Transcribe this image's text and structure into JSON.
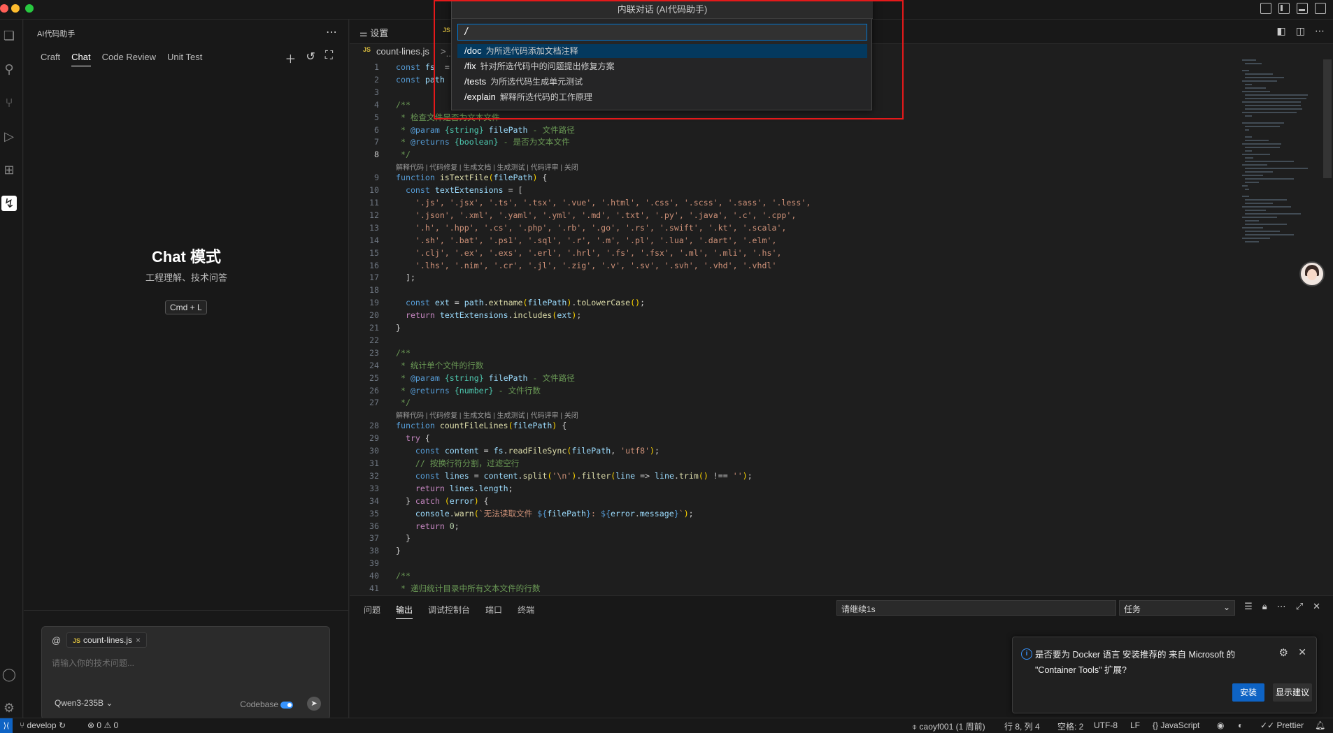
{
  "window": {
    "title": "内联对话 (AI代码助手)"
  },
  "sidebar": {
    "title": "AI代码助手",
    "tabs": [
      {
        "label": "Craft"
      },
      {
        "label": "Chat"
      },
      {
        "label": "Code Review"
      },
      {
        "label": "Unit Test"
      }
    ],
    "active_tab": "Chat",
    "mode_title": "Chat 模式",
    "mode_subtitle": "工程理解、技术问答",
    "shortcut": "Cmd + L",
    "chat_input": {
      "at": "@",
      "context_file": "count-lines.js",
      "placeholder": "请输入你的技术问题...",
      "model": "Qwen3-235B",
      "codebase_label": "Codebase",
      "codebase_enabled": true
    }
  },
  "tabs": {
    "settings": "设置",
    "file": "count-lines.js"
  },
  "breadcrumb": {
    "file": "count-lines.js",
    "rest": "..."
  },
  "inline_chat": {
    "input_value": "/",
    "commands": [
      {
        "cmd": "/doc",
        "desc": "为所选代码添加文档注释"
      },
      {
        "cmd": "/fix",
        "desc": "针对所选代码中的问题提出修复方案"
      },
      {
        "cmd": "/tests",
        "desc": "为所选代码生成单元测试"
      },
      {
        "cmd": "/explain",
        "desc": "解释所选代码的工作原理"
      }
    ]
  },
  "code_lens": "解释代码 | 代码修复 | 生成文档 | 生成测试 | 代码评审 | 关闭",
  "current_line": 8,
  "code_lines": [
    {
      "n": "1",
      "tokens": [
        [
          "k",
          "const "
        ],
        [
          "v",
          "fs"
        ],
        [
          "",
          "  = "
        ]
      ]
    },
    {
      "n": "2",
      "tokens": [
        [
          "k",
          "const "
        ],
        [
          "v",
          "path"
        ]
      ]
    },
    {
      "n": "3",
      "tokens": []
    },
    {
      "n": "4",
      "tokens": [
        [
          "c",
          "/**"
        ]
      ]
    },
    {
      "n": "5",
      "tokens": [
        [
          "c",
          " * 检查文件是否为文本文件"
        ]
      ]
    },
    {
      "n": "6",
      "tokens": [
        [
          "c",
          " * "
        ],
        [
          "k",
          "@param "
        ],
        [
          "t",
          "{string} "
        ],
        [
          "v",
          "filePath"
        ],
        [
          "c",
          " - 文件路径"
        ]
      ]
    },
    {
      "n": "7",
      "tokens": [
        [
          "c",
          " * "
        ],
        [
          "k",
          "@returns "
        ],
        [
          "t",
          "{boolean}"
        ],
        [
          "c",
          " - 是否为文本文件"
        ]
      ]
    },
    {
      "n": "8",
      "tokens": [
        [
          "c",
          " */"
        ]
      ]
    },
    {
      "n": "9",
      "tokens": [
        [
          "k",
          "function "
        ],
        [
          "f",
          "isTextFile"
        ],
        [
          "p",
          "("
        ],
        [
          "v",
          "filePath"
        ],
        [
          "p",
          ")"
        ],
        [
          "",
          " {"
        ]
      ]
    },
    {
      "n": "10",
      "tokens": [
        [
          "",
          "  "
        ],
        [
          "k",
          "const "
        ],
        [
          "v",
          "textExtensions"
        ],
        [
          "",
          " = ["
        ]
      ]
    },
    {
      "n": "11",
      "tokens": [
        [
          "s",
          "    '.js', '.jsx', '.ts', '.tsx', '.vue', '.html', '.css', '.scss', '.sass', '.less',"
        ]
      ]
    },
    {
      "n": "12",
      "tokens": [
        [
          "s",
          "    '.json', '.xml', '.yaml', '.yml', '.md', '.txt', '.py', '.java', '.c', '.cpp',"
        ]
      ]
    },
    {
      "n": "13",
      "tokens": [
        [
          "s",
          "    '.h', '.hpp', '.cs', '.php', '.rb', '.go', '.rs', '.swift', '.kt', '.scala',"
        ]
      ]
    },
    {
      "n": "14",
      "tokens": [
        [
          "s",
          "    '.sh', '.bat', '.ps1', '.sql', '.r', '.m', '.pl', '.lua', '.dart', '.elm',"
        ]
      ]
    },
    {
      "n": "15",
      "tokens": [
        [
          "s",
          "    '.clj', '.ex', '.exs', '.erl', '.hrl', '.fs', '.fsx', '.ml', '.mli', '.hs',"
        ]
      ]
    },
    {
      "n": "16",
      "tokens": [
        [
          "s",
          "    '.lhs', '.nim', '.cr', '.jl', '.zig', '.v', '.sv', '.svh', '.vhd', '.vhdl'"
        ]
      ]
    },
    {
      "n": "17",
      "tokens": [
        [
          "",
          "  ];"
        ]
      ]
    },
    {
      "n": "18",
      "tokens": []
    },
    {
      "n": "19",
      "tokens": [
        [
          "",
          "  "
        ],
        [
          "k",
          "const "
        ],
        [
          "v",
          "ext"
        ],
        [
          "",
          " = "
        ],
        [
          "v",
          "path"
        ],
        [
          "",
          "."
        ],
        [
          "f",
          "extname"
        ],
        [
          "p",
          "("
        ],
        [
          "v",
          "filePath"
        ],
        [
          "p",
          ")"
        ],
        [
          "",
          "."
        ],
        [
          "f",
          "toLowerCase"
        ],
        [
          "p",
          "()"
        ],
        [
          ";",
          ";"
        ]
      ]
    },
    {
      "n": "20",
      "tokens": [
        [
          "",
          "  "
        ],
        [
          "kc",
          "return "
        ],
        [
          "v",
          "textExtensions"
        ],
        [
          "",
          "."
        ],
        [
          "f",
          "includes"
        ],
        [
          "p",
          "("
        ],
        [
          "v",
          "ext"
        ],
        [
          "p",
          ")"
        ],
        [
          "",
          ";"
        ]
      ]
    },
    {
      "n": "21",
      "tokens": [
        [
          "",
          "}"
        ]
      ]
    },
    {
      "n": "22",
      "tokens": []
    },
    {
      "n": "23",
      "tokens": [
        [
          "c",
          "/**"
        ]
      ]
    },
    {
      "n": "24",
      "tokens": [
        [
          "c",
          " * 统计单个文件的行数"
        ]
      ]
    },
    {
      "n": "25",
      "tokens": [
        [
          "c",
          " * "
        ],
        [
          "k",
          "@param "
        ],
        [
          "t",
          "{string} "
        ],
        [
          "v",
          "filePath"
        ],
        [
          "c",
          " - 文件路径"
        ]
      ]
    },
    {
      "n": "26",
      "tokens": [
        [
          "c",
          " * "
        ],
        [
          "k",
          "@returns "
        ],
        [
          "t",
          "{number}"
        ],
        [
          "c",
          " - 文件行数"
        ]
      ]
    },
    {
      "n": "27",
      "tokens": [
        [
          "c",
          " */"
        ]
      ]
    },
    {
      "n": "28",
      "tokens": [
        [
          "k",
          "function "
        ],
        [
          "f",
          "countFileLines"
        ],
        [
          "p",
          "("
        ],
        [
          "v",
          "filePath"
        ],
        [
          "p",
          ")"
        ],
        [
          "",
          " {"
        ]
      ]
    },
    {
      "n": "29",
      "tokens": [
        [
          "",
          "  "
        ],
        [
          "kc",
          "try "
        ],
        [
          "",
          "{"
        ]
      ]
    },
    {
      "n": "30",
      "tokens": [
        [
          "",
          "    "
        ],
        [
          "k",
          "const "
        ],
        [
          "v",
          "content"
        ],
        [
          "",
          " = "
        ],
        [
          "v",
          "fs"
        ],
        [
          "",
          "."
        ],
        [
          "f",
          "readFileSync"
        ],
        [
          "p",
          "("
        ],
        [
          "v",
          "filePath"
        ],
        [
          "",
          ", "
        ],
        [
          "s",
          "'utf8'"
        ],
        [
          "p",
          ")"
        ],
        [
          "",
          ";"
        ]
      ]
    },
    {
      "n": "31",
      "tokens": [
        [
          "c",
          "    // 按换行符分割，过滤空行"
        ]
      ]
    },
    {
      "n": "32",
      "tokens": [
        [
          "",
          "    "
        ],
        [
          "k",
          "const "
        ],
        [
          "v",
          "lines"
        ],
        [
          "",
          " = "
        ],
        [
          "v",
          "content"
        ],
        [
          "",
          "."
        ],
        [
          "f",
          "split"
        ],
        [
          "p",
          "("
        ],
        [
          "s",
          "'\\n'"
        ],
        [
          "p",
          ")"
        ],
        [
          "",
          "."
        ],
        [
          "f",
          "filter"
        ],
        [
          "p",
          "("
        ],
        [
          "v",
          "line"
        ],
        [
          "",
          " => "
        ],
        [
          "v",
          "line"
        ],
        [
          "",
          "."
        ],
        [
          "f",
          "trim"
        ],
        [
          "p",
          "()"
        ],
        [
          "",
          " !== "
        ],
        [
          "s",
          "''"
        ],
        [
          "p",
          ")"
        ],
        [
          "",
          ";"
        ]
      ]
    },
    {
      "n": "33",
      "tokens": [
        [
          "",
          "    "
        ],
        [
          "kc",
          "return "
        ],
        [
          "v",
          "lines"
        ],
        [
          "",
          "."
        ],
        [
          "v",
          "length"
        ],
        [
          "",
          ";"
        ]
      ]
    },
    {
      "n": "34",
      "tokens": [
        [
          "",
          "  } "
        ],
        [
          "kc",
          "catch "
        ],
        [
          "p",
          "("
        ],
        [
          "v",
          "error"
        ],
        [
          "p",
          ")"
        ],
        [
          "",
          " {"
        ]
      ]
    },
    {
      "n": "35",
      "tokens": [
        [
          "",
          "    "
        ],
        [
          "v",
          "console"
        ],
        [
          "",
          "."
        ],
        [
          "f",
          "warn"
        ],
        [
          "p",
          "("
        ],
        [
          "s",
          "`无法读取文件 "
        ],
        [
          "k",
          "${"
        ],
        [
          "v",
          "filePath"
        ],
        [
          "k",
          "}"
        ],
        [
          "s",
          ": "
        ],
        [
          "k",
          "${"
        ],
        [
          "v",
          "error"
        ],
        [
          "",
          "."
        ],
        [
          "v",
          "message"
        ],
        [
          "k",
          "}"
        ],
        [
          "s",
          "`"
        ],
        [
          "p",
          ")"
        ],
        [
          "",
          ";"
        ]
      ]
    },
    {
      "n": "36",
      "tokens": [
        [
          "",
          "    "
        ],
        [
          "kc",
          "return "
        ],
        [
          "n",
          "0"
        ],
        [
          "",
          ";"
        ]
      ]
    },
    {
      "n": "37",
      "tokens": [
        [
          "",
          "  }"
        ]
      ]
    },
    {
      "n": "38",
      "tokens": [
        [
          "",
          "}"
        ]
      ]
    },
    {
      "n": "39",
      "tokens": []
    },
    {
      "n": "40",
      "tokens": [
        [
          "c",
          "/**"
        ]
      ]
    },
    {
      "n": "41",
      "tokens": [
        [
          "c",
          " * 递归统计目录中所有文本文件的行数"
        ]
      ]
    }
  ],
  "panel": {
    "tabs": [
      {
        "label": "问题"
      },
      {
        "label": "输出"
      },
      {
        "label": "调试控制台"
      },
      {
        "label": "端口"
      },
      {
        "label": "终端"
      }
    ],
    "active_tab": "输出",
    "filter_value": "请继续1s",
    "task_select": "任务"
  },
  "notification": {
    "message": "是否要为 Docker 语言 安装推荐的 来自 Microsoft 的 \"Container Tools\" 扩展?",
    "install": "安装",
    "show_suggestions": "显示建议"
  },
  "statusbar": {
    "branch": "develop",
    "errors": "0",
    "warnings": "0",
    "blame": "caoyf001 (1 周前)",
    "position": "行 8, 列 4",
    "spaces": "空格: 2",
    "encoding": "UTF-8",
    "eol": "LF",
    "language": "JavaScript",
    "prettier": "Prettier"
  },
  "colors": {
    "accent": "#0e63c4",
    "highlight_box": "#e5191a",
    "selection": "#04395e",
    "background": "#1e1e1e"
  },
  "icons": [
    "files-icon",
    "search-icon",
    "source-control-icon",
    "run-debug-icon",
    "extensions-icon",
    "ai-assistant-icon",
    "account-icon",
    "settings-gear-icon"
  ]
}
